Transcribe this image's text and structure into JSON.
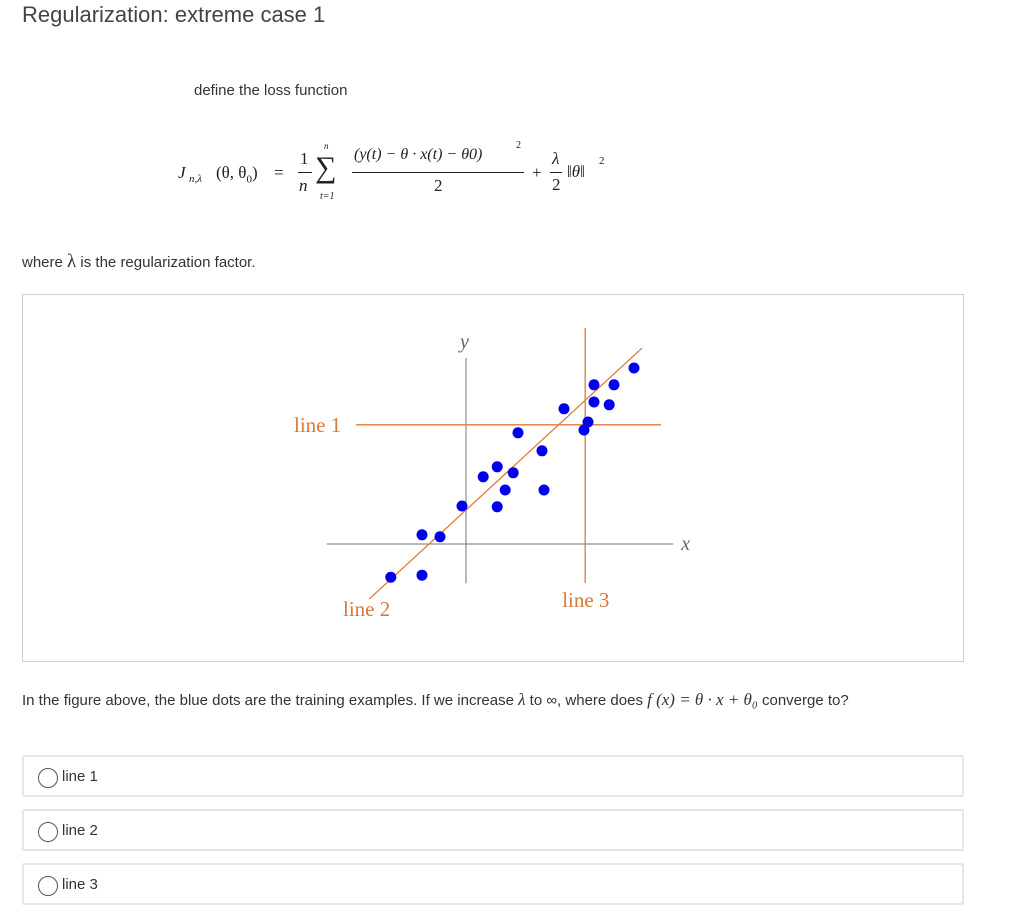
{
  "title": "Regularization: extreme case 1",
  "intro": "define the loss function",
  "formula": {
    "lhs": "J",
    "lhs_sub": "n,λ",
    "lhs_args": "(θ, θ",
    "lhs_args_sub": "0",
    "lhs_args_close": ")",
    "equals": "=",
    "one": "1",
    "n": "n",
    "sum": "∑",
    "sum_top": "n",
    "sum_bottom": "t=1",
    "numerator": "(y(t) − θ · x(t) − θ0)",
    "numerator_exp": "2",
    "denominator": "2",
    "plus": "+",
    "lambda": "λ",
    "two": "2",
    "norm": "‖θ‖",
    "norm_exp": "2"
  },
  "where_prefix": "where",
  "where_lambda": "λ",
  "where_suffix": "is the regularization factor.",
  "question": {
    "part1": "In the figure above, the blue dots are the training examples. If we increase ",
    "lambda": "λ",
    "part2": " to ∞, where does ",
    "math": "f (x) = θ · x + θ₀",
    "part3": " converge to?"
  },
  "options": [
    {
      "label": "line 1",
      "selected": false
    },
    {
      "label": "line 2",
      "selected": false
    },
    {
      "label": "line 3",
      "selected": false
    }
  ],
  "colors": {
    "dots": "#0000ee",
    "lines": "#e07b39",
    "axes": "#777777",
    "line_labels": "#d9783a"
  },
  "chart_data": {
    "type": "scatter",
    "xlabel": "x",
    "ylabel": "y",
    "axis_labels": {
      "x": "x",
      "y": "y"
    },
    "points": [
      {
        "x": -1.88,
        "y": -0.83
      },
      {
        "x": -1.1,
        "y": -0.78
      },
      {
        "x": -1.1,
        "y": 0.23
      },
      {
        "x": -0.65,
        "y": 0.18
      },
      {
        "x": -0.1,
        "y": 0.95
      },
      {
        "x": 0.78,
        "y": 0.93
      },
      {
        "x": 0.98,
        "y": 1.35
      },
      {
        "x": 0.43,
        "y": 1.68
      },
      {
        "x": 0.78,
        "y": 1.93
      },
      {
        "x": 1.18,
        "y": 1.78
      },
      {
        "x": 1.95,
        "y": 1.35
      },
      {
        "x": 1.3,
        "y": 2.78
      },
      {
        "x": 1.9,
        "y": 2.33
      },
      {
        "x": 2.45,
        "y": 3.38
      },
      {
        "x": 2.95,
        "y": 2.85
      },
      {
        "x": 3.05,
        "y": 3.05
      },
      {
        "x": 3.58,
        "y": 3.48
      },
      {
        "x": 3.2,
        "y": 3.55
      },
      {
        "x": 3.7,
        "y": 3.98
      },
      {
        "x": 3.2,
        "y": 3.98
      },
      {
        "x": 4.2,
        "y": 4.4
      }
    ],
    "lines": [
      {
        "name": "line 1",
        "kind": "horizontal",
        "y": 2.98
      },
      {
        "name": "line 2",
        "kind": "slope",
        "slope": 0.92,
        "intercept": 0.85
      },
      {
        "name": "line 3",
        "kind": "vertical",
        "x": 2.98
      }
    ],
    "xlim": [
      -3.48,
      5.18
    ],
    "ylim": [
      -0.98,
      4.65
    ]
  }
}
